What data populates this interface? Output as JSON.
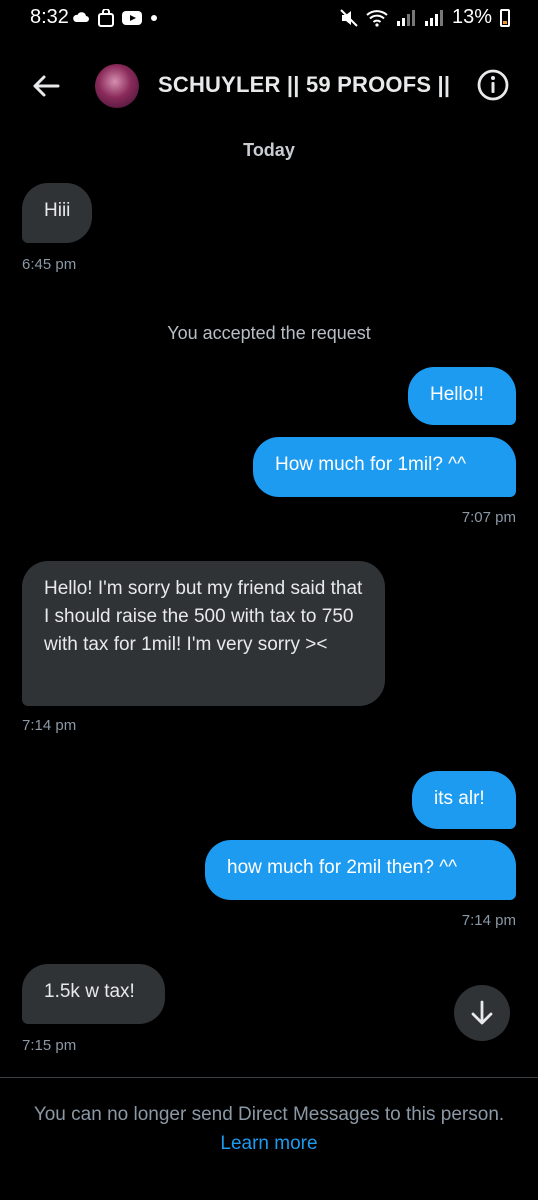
{
  "status_bar": {
    "time": "8:32",
    "battery": "13%"
  },
  "header": {
    "contact_name": "SCHUYLER || 59 PROOFS ||"
  },
  "conversation": {
    "date_label": "Today",
    "system_message": "You accepted the request",
    "messages": [
      {
        "direction": "in",
        "text": "Hiii",
        "time": "6:45 pm"
      },
      {
        "direction": "out",
        "text": "Hello!!"
      },
      {
        "direction": "out",
        "text": "How much for 1mil? ^^",
        "time": "7:07 pm"
      },
      {
        "direction": "in",
        "text": "Hello! I'm sorry but my friend said that I should raise the 500 with tax to 750 with tax for 1mil!  I'm very sorry ><",
        "time": "7:14 pm"
      },
      {
        "direction": "out",
        "text": "its alr!"
      },
      {
        "direction": "out",
        "text": "how much for 2mil then? ^^",
        "time": "7:14 pm"
      },
      {
        "direction": "in",
        "text": "1.5k w tax!",
        "time": "7:15 pm"
      }
    ]
  },
  "footer": {
    "notice": "You can no longer send Direct Messages to this person.",
    "learn_more": "Learn more"
  },
  "colors": {
    "background": "#000000",
    "incoming_bubble": "#2f3336",
    "outgoing_bubble": "#1d9bf0",
    "link": "#1d9bf0"
  }
}
